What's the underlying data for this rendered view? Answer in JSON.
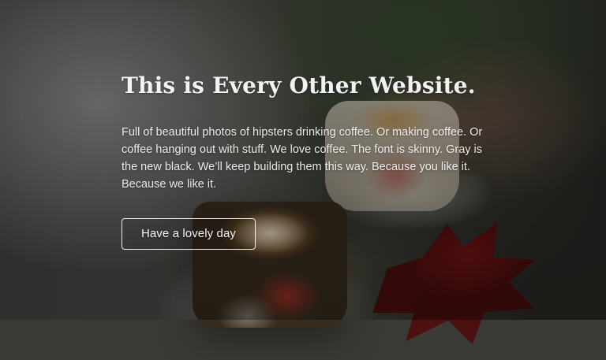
{
  "hero": {
    "title": "This is Every Other Website.",
    "paragraph": "Full of beautiful photos of hipsters drinking coffee. Or making coffee. Or coffee hanging out with stuff. We love coffee. The font is skinny. Gray is the new black. We’ll keep building them this way. Because you like it. Because we like it.",
    "button_label": "Have a lovely day"
  }
}
